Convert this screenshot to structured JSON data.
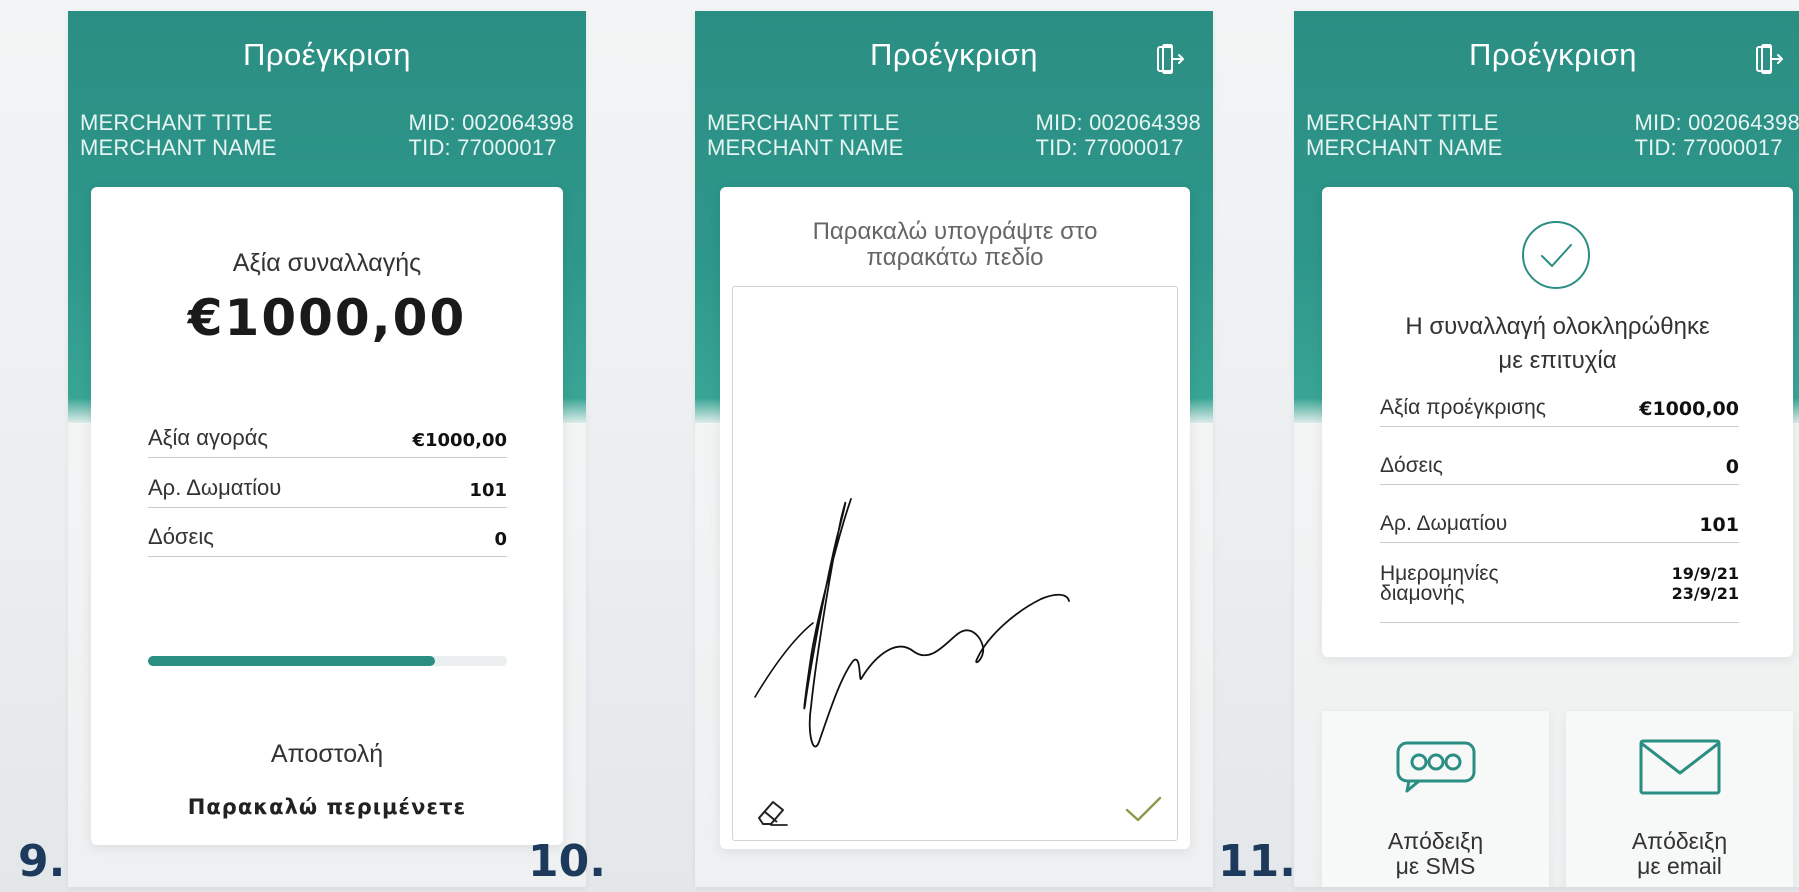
{
  "colors": {
    "teal": "#2b8e83",
    "label": "#1d3a5c",
    "check": "#8a9a4a"
  },
  "screens": [
    {
      "number": "9.",
      "title": "Προέγκριση",
      "merchant_title": "MERCHANT TITLE",
      "merchant_name": "MERCHANT NAME",
      "mid": "MID: 002064398",
      "tid": "TID: 77000017",
      "amount_label": "Αξία συναλλαγής",
      "amount_value": "€1000,00",
      "rows": [
        {
          "label": "Αξία αγοράς",
          "value": "€1000,00"
        },
        {
          "label": "Αρ. Δωματίου",
          "value": "101"
        },
        {
          "label": "Δόσεις",
          "value": "0"
        }
      ],
      "progress": 0.8,
      "status_text": "Αποστολή",
      "wait_text": "Παρακαλώ περιμένετε"
    },
    {
      "number": "10.",
      "title": "Προέγκριση",
      "merchant_title": "MERCHANT TITLE",
      "merchant_name": "MERCHANT NAME",
      "mid": "MID: 002064398",
      "tid": "TID: 77000017",
      "prompt_line1": "Παρακαλώ υπογράψτε στο",
      "prompt_line2": "παρακάτω πεδίο",
      "icons": {
        "exit": "exit-door-icon",
        "eraser": "eraser-icon",
        "confirm": "checkmark-icon"
      }
    },
    {
      "number": "11.",
      "title": "Προέγκριση",
      "merchant_title": "MERCHANT TITLE",
      "merchant_name": "MERCHANT NAME",
      "mid": "MID: 002064398",
      "tid": "TID: 77000017",
      "success_line1": "Η συναλλαγή ολοκληρώθηκε",
      "success_line2": "με επιτυχία",
      "rows": [
        {
          "label": "Αξία προέγκρισης",
          "value": "€1000,00"
        },
        {
          "label": "Δόσεις",
          "value": "0"
        },
        {
          "label": "Αρ. Δωματίου",
          "value": "101"
        }
      ],
      "stay_label_line1": "Ημερομηνίες",
      "stay_label_line2": "διαμονής",
      "stay_from": "19/9/21",
      "stay_to": "23/9/21",
      "receipt_sms_line1": "Απόδειξη",
      "receipt_sms_line2": "με SMS",
      "receipt_email_line1": "Απόδειξη",
      "receipt_email_line2": "με email",
      "icons": {
        "exit": "exit-door-icon",
        "success": "success-check-circle-icon",
        "sms": "sms-bubble-icon",
        "email": "envelope-icon"
      }
    }
  ]
}
